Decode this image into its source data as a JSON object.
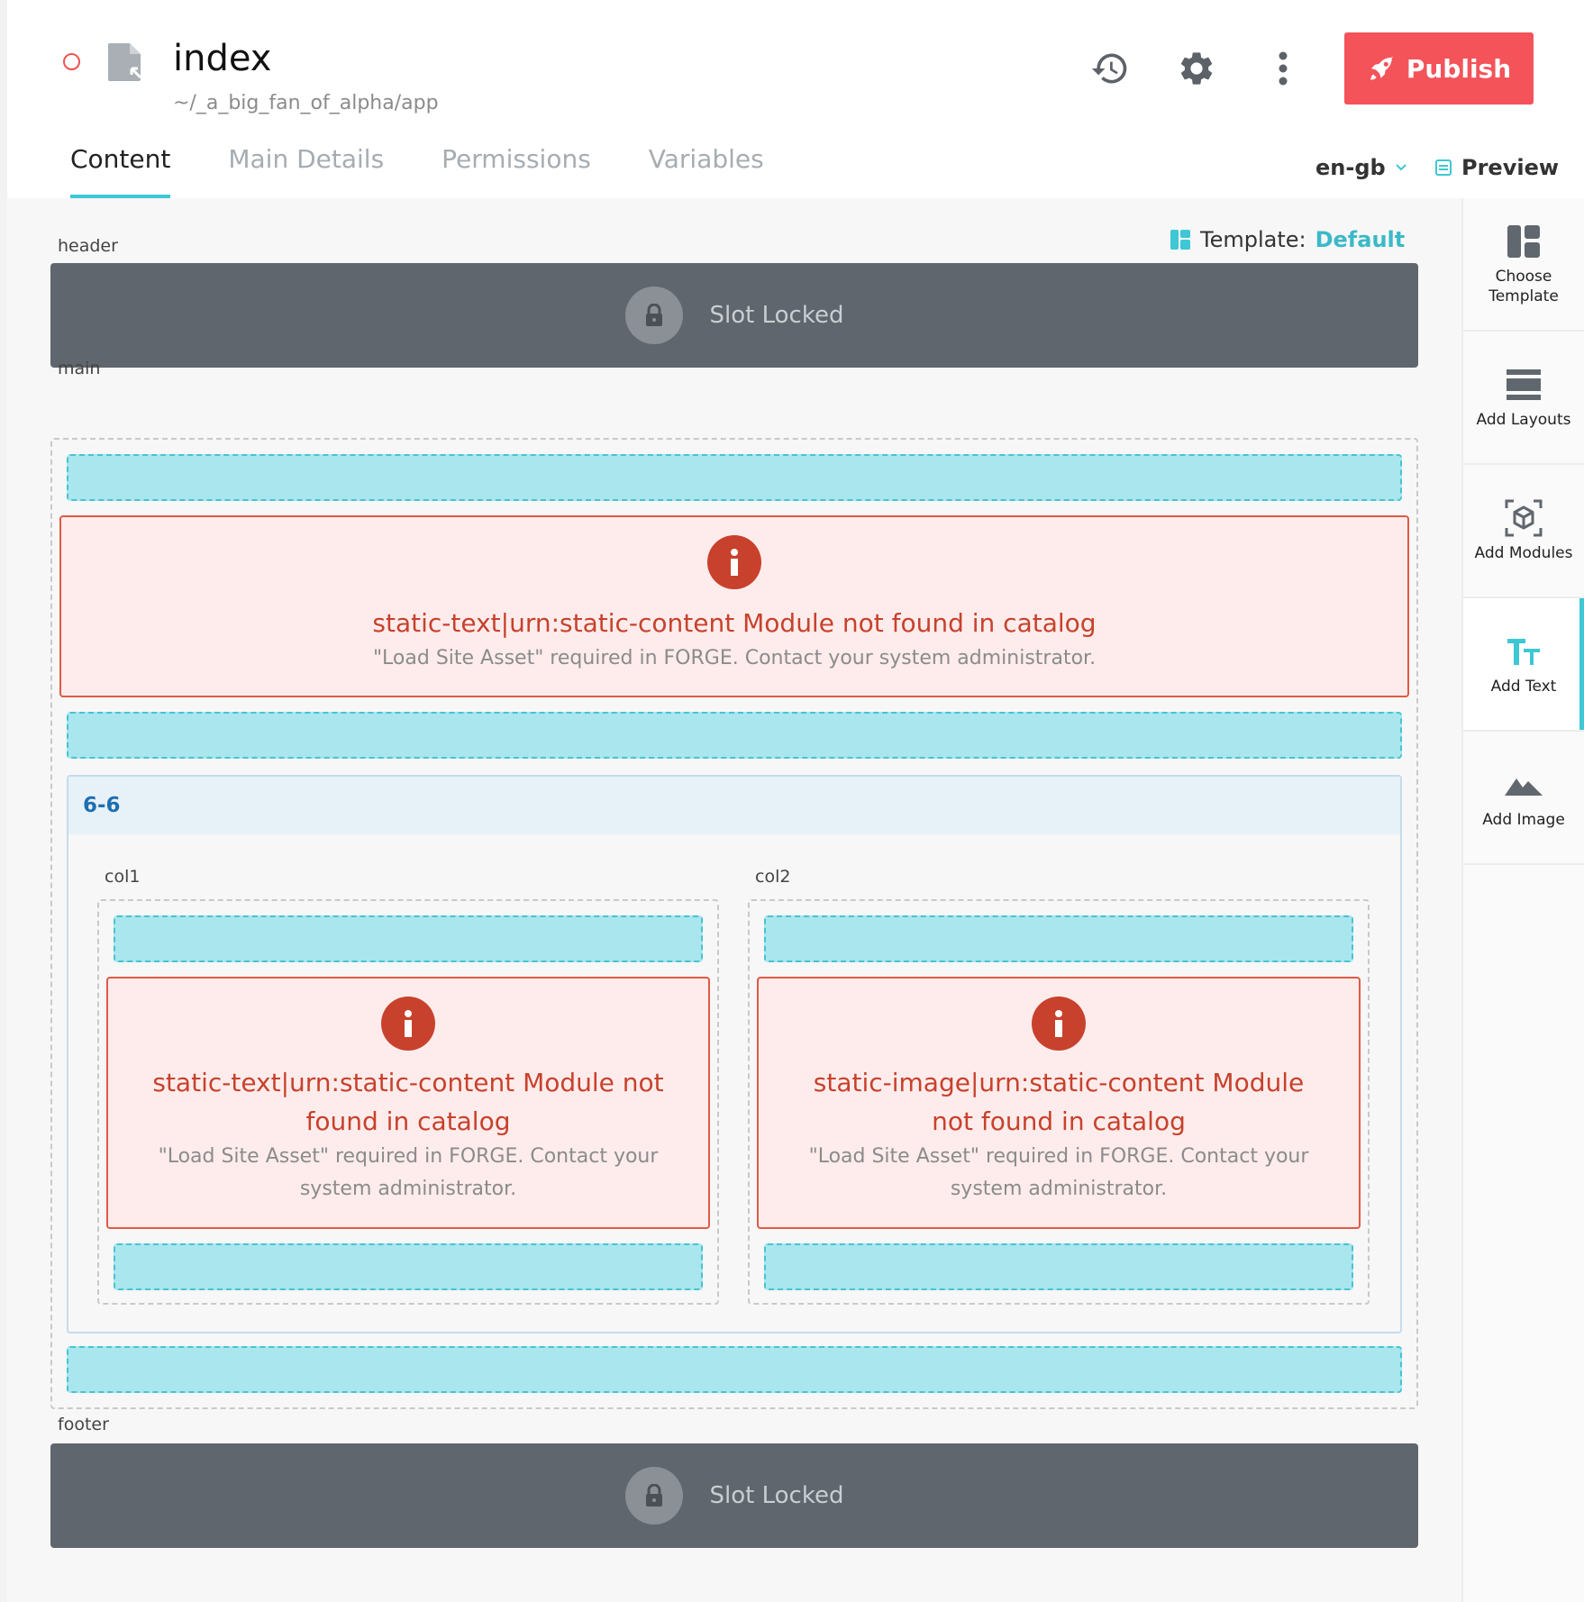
{
  "page": {
    "title": "index",
    "path": "~/_a_big_fan_of_alpha/app"
  },
  "toolbar": {
    "publish_label": "Publish",
    "icons": [
      "history-icon",
      "gear-icon",
      "more-vertical-icon",
      "rocket-icon"
    ]
  },
  "tabs": [
    {
      "label": "Content",
      "active": true
    },
    {
      "label": "Main Details",
      "active": false
    },
    {
      "label": "Permissions",
      "active": false
    },
    {
      "label": "Variables",
      "active": false
    }
  ],
  "locale": {
    "value": "en-gb"
  },
  "preview": {
    "label": "Preview"
  },
  "template": {
    "label": "Template:",
    "value": "Default"
  },
  "slots": {
    "header": {
      "label": "header",
      "locked_text": "Slot Locked"
    },
    "main": {
      "label": "main"
    },
    "footer": {
      "label": "footer",
      "locked_text": "Slot Locked"
    }
  },
  "errors": [
    {
      "title": "static-text|urn:static-content Module not found in catalog",
      "desc": "\"Load Site Asset\" required in FORGE. Contact your system administrator."
    },
    {
      "title": "static-text|urn:static-content Module not found in catalog",
      "desc": "\"Load Site Asset\" required in FORGE. Contact your system administrator."
    },
    {
      "title": "static-image|urn:static-content Module not found in catalog",
      "desc": "\"Load Site Asset\" required in FORGE. Contact your system administrator."
    }
  ],
  "layout": {
    "name": "6-6",
    "col1": "col1",
    "col2": "col2"
  },
  "sidebar": {
    "items": [
      {
        "label": "Choose Template",
        "icon": "template-icon"
      },
      {
        "label": "Add Layouts",
        "icon": "layouts-icon"
      },
      {
        "label": "Add Modules",
        "icon": "module-cube-icon"
      },
      {
        "label": "Add Text",
        "icon": "text-icon"
      },
      {
        "label": "Add Image",
        "icon": "image-icon"
      }
    ]
  },
  "colors": {
    "accent": "#3ec7d4",
    "publish": "#f4535a",
    "error": "#c8412c",
    "locked": "#5f666d",
    "dropzone": "#a9e6ee"
  }
}
